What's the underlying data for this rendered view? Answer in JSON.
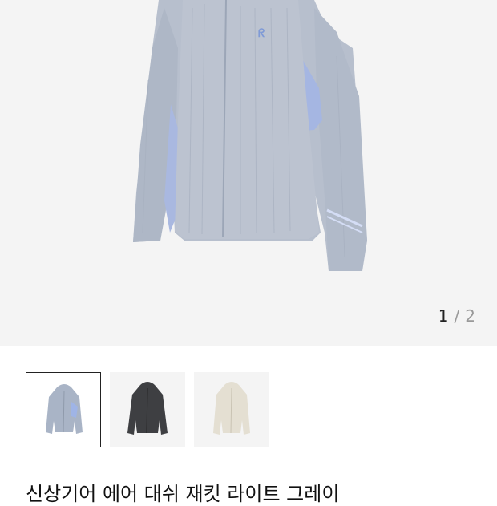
{
  "product": {
    "title": "신상기어 에어 대쉬 재킷 라이트 그레이"
  },
  "gallery": {
    "current": "1",
    "separator": "/",
    "total": "2",
    "main_image": "jacket-light-grey-photo"
  },
  "thumbnails": [
    {
      "name": "light-grey",
      "color": "#a9b4c6",
      "selected": true
    },
    {
      "name": "dark-grey",
      "color": "#3e3f42",
      "selected": false
    },
    {
      "name": "beige",
      "color": "#e4dfd2",
      "selected": false
    }
  ],
  "colors": {
    "hero_bg": "#f4f4f4",
    "jacket_main": "#b3bccb",
    "jacket_accent": "#9fb4e6"
  }
}
